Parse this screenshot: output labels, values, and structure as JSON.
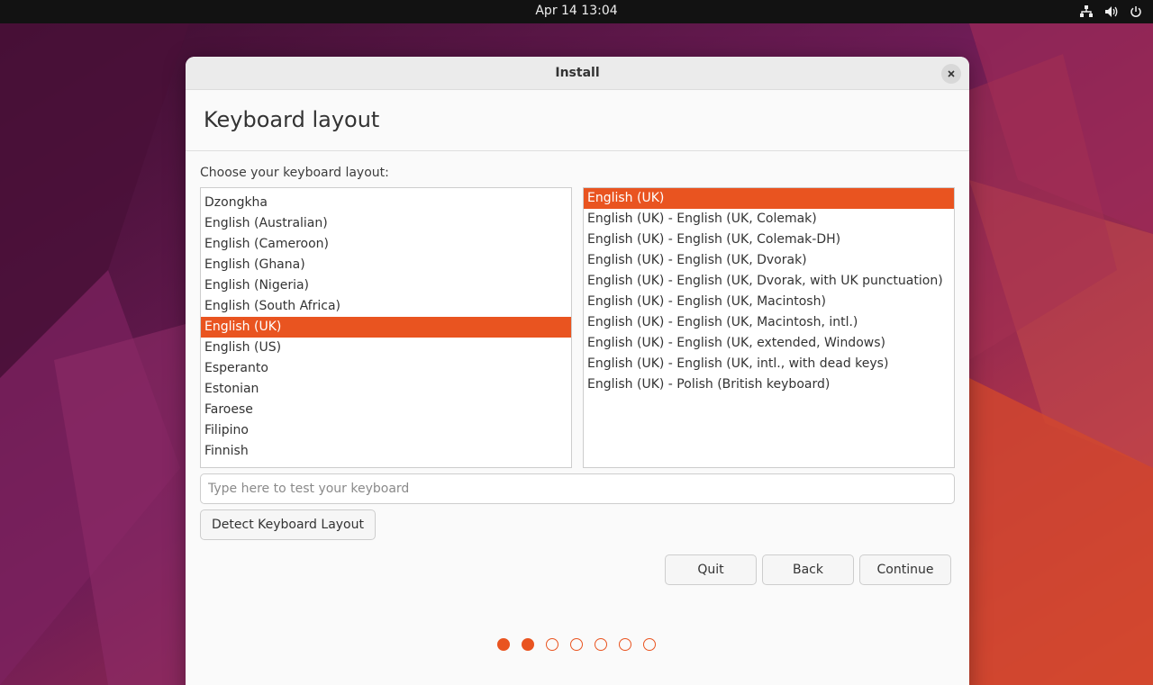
{
  "topbar": {
    "datetime": "Apr 14  13:04",
    "icons": [
      "network-icon",
      "volume-icon",
      "power-icon"
    ]
  },
  "window": {
    "title": "Install",
    "close_icon": "close-icon"
  },
  "page": {
    "title": "Keyboard layout",
    "prompt": "Choose your keyboard layout:"
  },
  "layouts": [
    {
      "label": "Dzongkha",
      "selected": false
    },
    {
      "label": "English (Australian)",
      "selected": false
    },
    {
      "label": "English (Cameroon)",
      "selected": false
    },
    {
      "label": "English (Ghana)",
      "selected": false
    },
    {
      "label": "English (Nigeria)",
      "selected": false
    },
    {
      "label": "English (South Africa)",
      "selected": false
    },
    {
      "label": "English (UK)",
      "selected": true
    },
    {
      "label": "English (US)",
      "selected": false
    },
    {
      "label": "Esperanto",
      "selected": false
    },
    {
      "label": "Estonian",
      "selected": false
    },
    {
      "label": "Faroese",
      "selected": false
    },
    {
      "label": "Filipino",
      "selected": false
    },
    {
      "label": "Finnish",
      "selected": false
    }
  ],
  "variants": [
    {
      "label": "English (UK)",
      "selected": true
    },
    {
      "label": "English (UK) - English (UK, Colemak)",
      "selected": false
    },
    {
      "label": "English (UK) - English (UK, Colemak-DH)",
      "selected": false
    },
    {
      "label": "English (UK) - English (UK, Dvorak)",
      "selected": false
    },
    {
      "label": "English (UK) - English (UK, Dvorak, with UK punctuation)",
      "selected": false
    },
    {
      "label": "English (UK) - English (UK, Macintosh)",
      "selected": false
    },
    {
      "label": "English (UK) - English (UK, Macintosh, intl.)",
      "selected": false
    },
    {
      "label": "English (UK) - English (UK, extended, Windows)",
      "selected": false
    },
    {
      "label": "English (UK) - English (UK, intl., with dead keys)",
      "selected": false
    },
    {
      "label": "English (UK) - Polish (British keyboard)",
      "selected": false
    }
  ],
  "test_input": {
    "placeholder": "Type here to test your keyboard",
    "value": ""
  },
  "buttons": {
    "detect": "Detect Keyboard Layout",
    "quit": "Quit",
    "back": "Back",
    "continue": "Continue"
  },
  "progress": {
    "total_steps": 7,
    "completed_steps": 2
  },
  "colors": {
    "accent": "#e95420",
    "topbar": "#121212",
    "window_bg": "#fafafa"
  }
}
